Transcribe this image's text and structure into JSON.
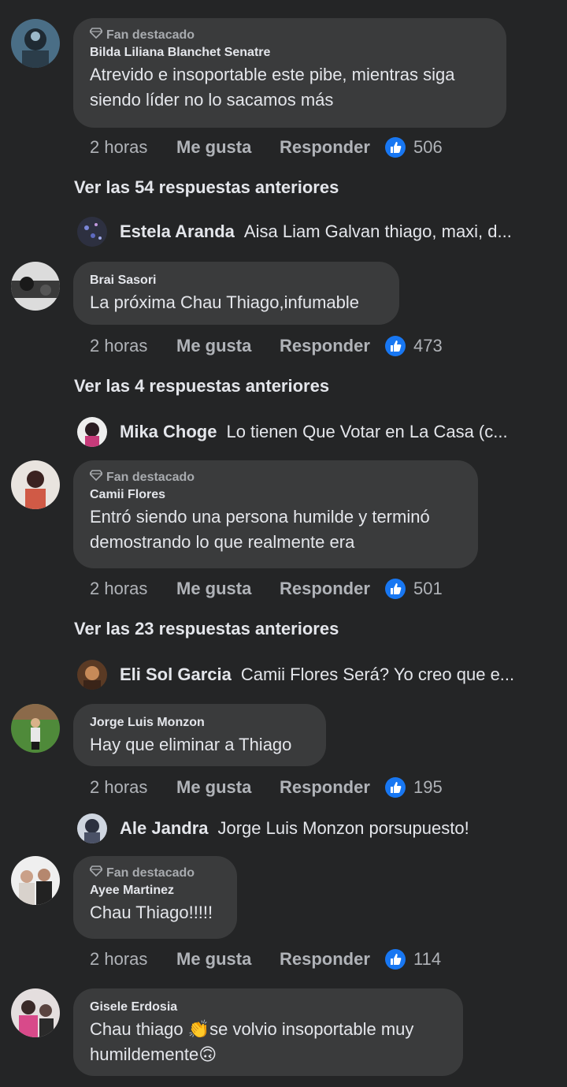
{
  "comments": [
    {
      "badge": "Fan destacado",
      "author": "Bilda Liliana Blanchet Senatre",
      "text": "Atrevido e insoportable este pibe, mientras siga siendo líder no lo sacamos más",
      "time": "2 horas",
      "like_label": "Me gusta",
      "reply_label": "Responder",
      "likes": "506",
      "more_replies": "Ver las 54 respuestas anteriores",
      "reply": {
        "name": "Estela Aranda",
        "text": "Aisa Liam Galvan thiago, maxi, d..."
      }
    },
    {
      "author": "Brai Sasori",
      "text": "La próxima Chau Thiago,infumable",
      "time": "2 horas",
      "like_label": "Me gusta",
      "reply_label": "Responder",
      "likes": "473",
      "more_replies": "Ver las 4 respuestas anteriores",
      "reply": {
        "name": "Mika Choge",
        "text": "Lo tienen Que Votar en La Casa (c..."
      }
    },
    {
      "badge": "Fan destacado",
      "author": "Camii Flores",
      "text": "Entró siendo una persona humilde y terminó demostrando lo que realmente era",
      "time": "2 horas",
      "like_label": "Me gusta",
      "reply_label": "Responder",
      "likes": "501",
      "more_replies": "Ver las 23 respuestas anteriores",
      "reply": {
        "name": "Eli Sol Garcia",
        "text": "Camii Flores Será? Yo creo que e..."
      }
    },
    {
      "author": "Jorge Luis Monzon",
      "text": "Hay que eliminar a Thiago",
      "time": "2 horas",
      "like_label": "Me gusta",
      "reply_label": "Responder",
      "likes": "195",
      "reply": {
        "name": "Ale Jandra",
        "text": "Jorge Luis Monzon porsupuesto!"
      }
    },
    {
      "badge": "Fan destacado",
      "author": "Ayee Martinez",
      "text": "Chau Thiago!!!!!",
      "time": "2 horas",
      "like_label": "Me gusta",
      "reply_label": "Responder",
      "likes": "114"
    },
    {
      "author": "Gisele Erdosia",
      "text_part1": "Chau thiago ",
      "emoji1": "👏",
      "text_part2": "se volvio insoportable muy humildemente",
      "emoji2": "🙃"
    }
  ],
  "colors": {
    "background": "#242526",
    "bubble": "#3a3b3c",
    "text": "#e4e6eb",
    "secondary": "#b0b3b8",
    "like_blue": "#1877f2"
  }
}
